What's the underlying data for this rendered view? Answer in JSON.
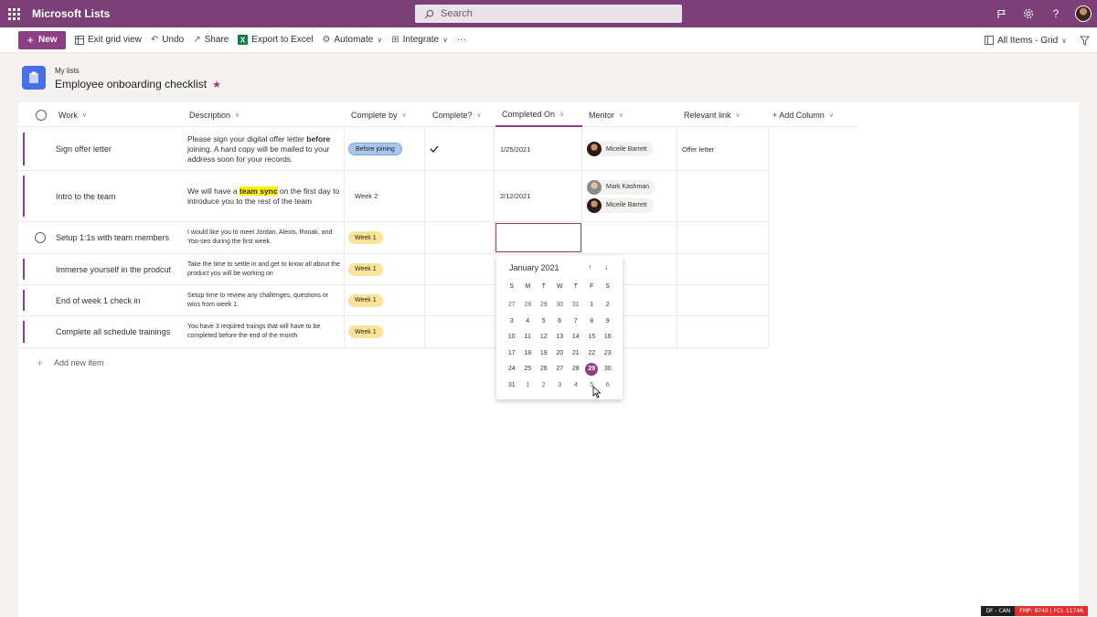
{
  "app": {
    "title": "Microsoft Lists",
    "search_placeholder": "Search"
  },
  "commands": {
    "new": "New",
    "exit_grid": "Exit grid view",
    "undo": "Undo",
    "share": "Share",
    "export": "Export to Excel",
    "automate": "Automate",
    "integrate": "Integrate",
    "more": "···",
    "view": "All Items - Grid"
  },
  "header": {
    "breadcrumb": "My lists",
    "title": "Employee onboarding checklist"
  },
  "columns": {
    "work": "Work",
    "description": "Description",
    "complete_by": "Complete by",
    "complete": "Complete?",
    "completed_on": "Completed On",
    "mentor": "Mentor",
    "relevant_link": "Relevant link",
    "add_column": "+ Add Column"
  },
  "rows": [
    {
      "work": "Sign offer letter",
      "desc_a": "Please sign your digital offer letter ",
      "desc_b": "before",
      "desc_c": " joining. A hard copy will be mailed to your address soon for your records.",
      "complete_by": "Before joining",
      "completed_on": "1/25/2021",
      "mentor": "Miceile Barrett",
      "link": "Offer letter"
    },
    {
      "work": "Intro to the team",
      "desc_a": "We will have a ",
      "desc_b": "team sync",
      "desc_c": " on the first day to introduce you to the rest of the team",
      "complete_by": "Week 2",
      "completed_on": "2/12/2021",
      "mentor1": "Mark Kashman",
      "mentor2": "Miceile Barrett"
    },
    {
      "work": "Setup 1:1s with team members",
      "desc": "I would like you to meet Jordan, Alexis, Ronak, and Yoo-seo during the first week.",
      "complete_by": "Week 1"
    },
    {
      "work": "Immerse yourself in the prodcut",
      "desc": "Take the time to settle in and get to know all about the product you will be working on",
      "complete_by": "Week 1"
    },
    {
      "work": "End of week 1 check in",
      "desc": "Setup time to review any challenges, questions or wins from week 1.",
      "complete_by": "Week 1"
    },
    {
      "work": "Complete all schedule trainings",
      "desc": "You have 3 required traings that will have to be completed before the end of the month",
      "complete_by": "Week 1"
    }
  ],
  "add_item": "Add new item",
  "datepicker": {
    "month": "January 2021",
    "dow": [
      "S",
      "M",
      "T",
      "W",
      "T",
      "F",
      "S"
    ],
    "days": [
      "27",
      "28",
      "29",
      "30",
      "31",
      "1",
      "2",
      "3",
      "4",
      "5",
      "6",
      "7",
      "8",
      "9",
      "10",
      "11",
      "12",
      "13",
      "14",
      "15",
      "16",
      "17",
      "18",
      "19",
      "20",
      "21",
      "22",
      "23",
      "24",
      "25",
      "26",
      "27",
      "28",
      "29",
      "30",
      "31",
      "1",
      "2",
      "3",
      "4",
      "5",
      "6"
    ],
    "selected": "29"
  },
  "status": {
    "left": "DF - CAN",
    "right": "FMP: 9740 | FCI: 11746"
  },
  "colors": {
    "accent": "#8c3f84",
    "suitebar": "#7c3f78"
  }
}
